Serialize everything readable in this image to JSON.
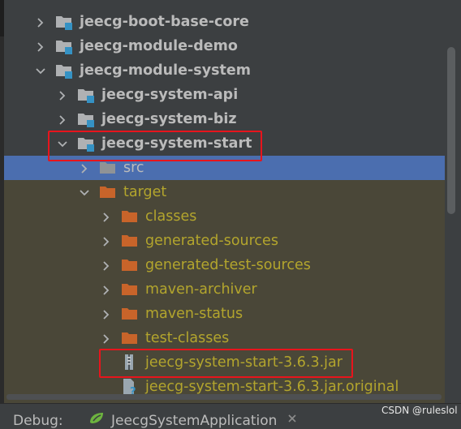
{
  "tree": {
    "items": [
      {
        "label": "jeecg-boot-base-core",
        "kind": "module",
        "expanded": false
      },
      {
        "label": "jeecg-module-demo",
        "kind": "module",
        "expanded": false
      },
      {
        "label": "jeecg-module-system",
        "kind": "module",
        "expanded": true
      },
      {
        "label": "jeecg-system-api",
        "kind": "module",
        "expanded": false
      },
      {
        "label": "jeecg-system-biz",
        "kind": "module",
        "expanded": false
      },
      {
        "label": "jeecg-system-start",
        "kind": "module",
        "expanded": true,
        "highlighted": true
      },
      {
        "label": "src",
        "kind": "folder",
        "expanded": false,
        "selected": true
      },
      {
        "label": "target",
        "kind": "folder-excluded",
        "expanded": true
      },
      {
        "label": "classes",
        "kind": "folder-excluded",
        "expanded": false
      },
      {
        "label": "generated-sources",
        "kind": "folder-excluded",
        "expanded": false
      },
      {
        "label": "generated-test-sources",
        "kind": "folder-excluded",
        "expanded": false
      },
      {
        "label": "maven-archiver",
        "kind": "folder-excluded",
        "expanded": false
      },
      {
        "label": "maven-status",
        "kind": "folder-excluded",
        "expanded": false
      },
      {
        "label": "test-classes",
        "kind": "folder-excluded",
        "expanded": false
      },
      {
        "label": "jeecg-system-start-3.6.3.jar",
        "kind": "jar",
        "highlighted": true
      },
      {
        "label": "jeecg-system-start-3.6.3.jar.original",
        "kind": "unknown-file"
      }
    ]
  },
  "debug": {
    "label": "Debug:",
    "tab_name": "JeecgSystemApplication"
  },
  "watermark": "CSDN @ruleslol",
  "colors": {
    "panel_bg": "#3c3f41",
    "selection": "#4b6eaf",
    "excluded_bg": "#4a4738",
    "excluded_text": "#b3a52d",
    "highlight_box": "#e8141c",
    "folder_orange": "#c8642a",
    "module_blue": "#3592c4"
  },
  "icons": {
    "collapsed": "chevron-right-icon",
    "expanded": "chevron-down-icon",
    "module": "module-folder-icon",
    "folder": "folder-icon",
    "excluded": "excluded-folder-icon",
    "jar": "jar-file-icon",
    "unknown": "unknown-file-icon",
    "run": "spring-boot-icon",
    "close": "close-icon"
  }
}
